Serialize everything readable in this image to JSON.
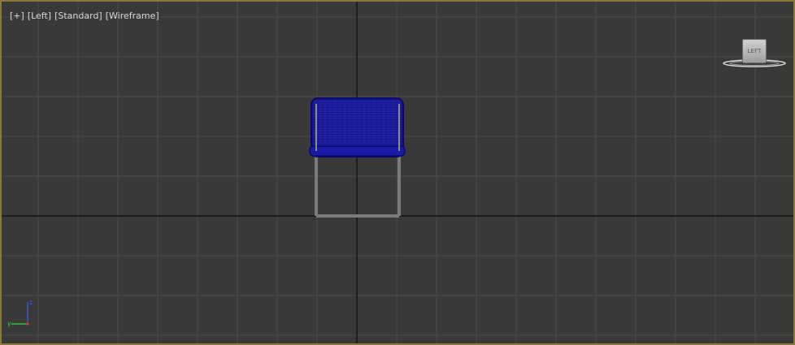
{
  "viewport": {
    "labels": [
      "[+]",
      "[Left]",
      "[Standard]",
      "[Wireframe]"
    ],
    "border_color": "#8a7a3a",
    "background": "#393939"
  },
  "viewcube": {
    "face_label": "LEFT"
  },
  "axis_tripod": {
    "vertical_axis": "z",
    "horizontal_axis": "y",
    "colors": {
      "z": "#3a5cff",
      "y": "#3fd13f",
      "x": "#e03030"
    }
  },
  "object": {
    "type": "chair",
    "seat_color": "#1a1aa6",
    "frame_color": "#7a7a7a"
  }
}
